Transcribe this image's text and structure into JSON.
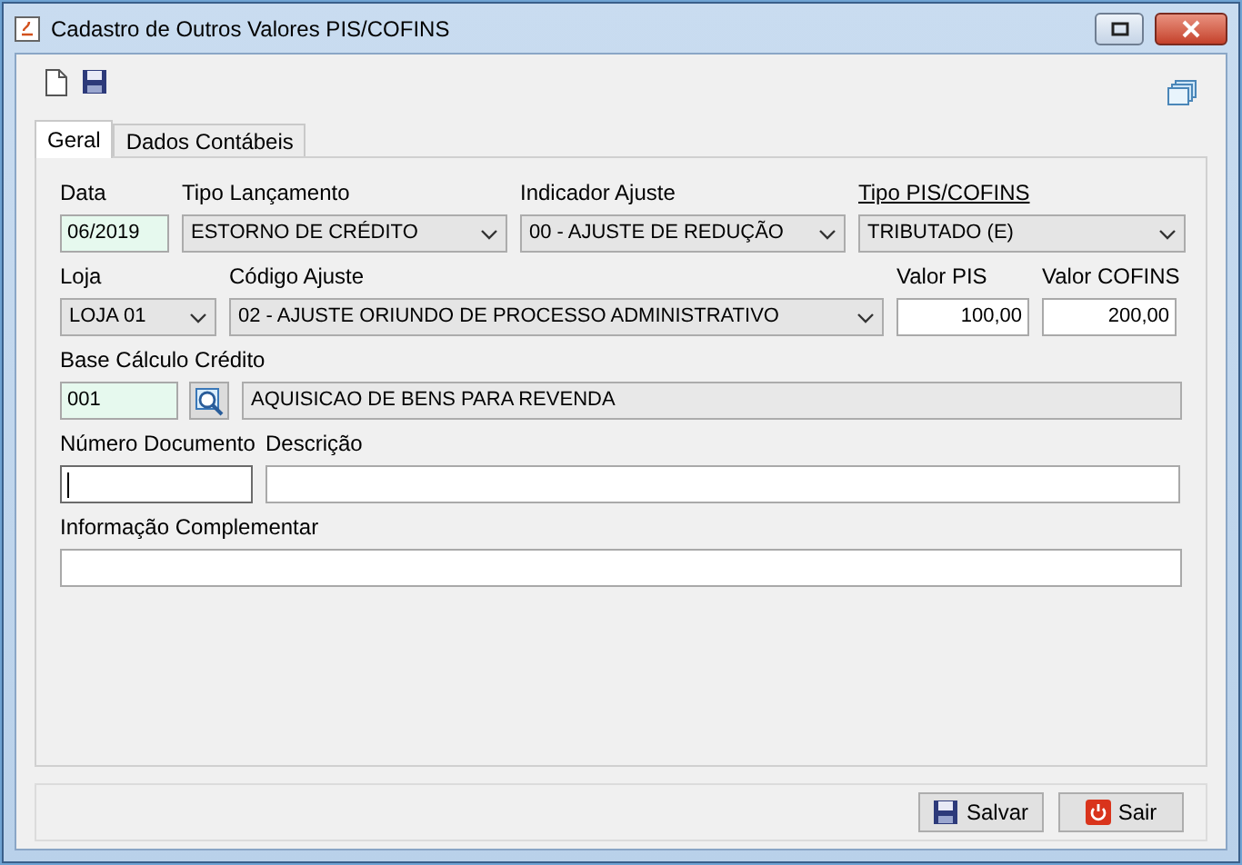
{
  "window": {
    "title": "Cadastro de Outros Valores PIS/COFINS"
  },
  "tabs": [
    {
      "label": "Geral",
      "selected": true
    },
    {
      "label": "Dados Contábeis",
      "selected": false
    }
  ],
  "rows": [
    [
      {
        "label": "Data",
        "kind": "text",
        "value": "06/2019",
        "required": true,
        "label_link": false,
        "focused": false
      },
      {
        "label": "Tipo Lançamento",
        "kind": "select",
        "value": "ESTORNO DE CRÉDITO",
        "required": false,
        "label_link": false
      },
      {
        "label": "Indicador Ajuste",
        "kind": "select",
        "value": "00 - AJUSTE DE REDUÇÃO",
        "required": false,
        "label_link": false
      },
      {
        "label": "Tipo PIS/COFINS",
        "kind": "select",
        "value": "TRIBUTADO (E)",
        "required": false,
        "label_link": true
      }
    ],
    [
      {
        "label": "Loja",
        "kind": "select",
        "value": "LOJA 01",
        "required": false,
        "label_link": false
      },
      {
        "label": "Código Ajuste",
        "kind": "select",
        "value": "02 - AJUSTE ORIUNDO DE PROCESSO ADMINISTRATIVO",
        "required": false,
        "label_link": false
      },
      {
        "label": "Valor PIS",
        "kind": "number",
        "value": "100,00",
        "required": false,
        "label_link": false,
        "focused": false
      },
      {
        "label": "Valor COFINS",
        "kind": "number",
        "value": "200,00",
        "required": false,
        "label_link": false,
        "focused": false
      }
    ],
    [
      {
        "label": "Base Cálculo Crédito",
        "kind": "lookup",
        "value": "001",
        "description": "AQUISICAO DE BENS PARA REVENDA",
        "required": true,
        "label_link": false
      }
    ],
    [
      {
        "label": "Número Documento",
        "kind": "text",
        "required": false,
        "label_link": false,
        "focused": true
      },
      {
        "label": "Descrição",
        "kind": "text",
        "required": false,
        "label_link": false,
        "focused": false
      }
    ],
    [
      {
        "label": "Informação Complementar",
        "kind": "text",
        "required": false,
        "label_link": false,
        "focused": false
      }
    ]
  ],
  "buttons": [
    {
      "label": "Salvar",
      "kind": "save"
    },
    {
      "label": "Sair",
      "kind": "exit"
    }
  ]
}
